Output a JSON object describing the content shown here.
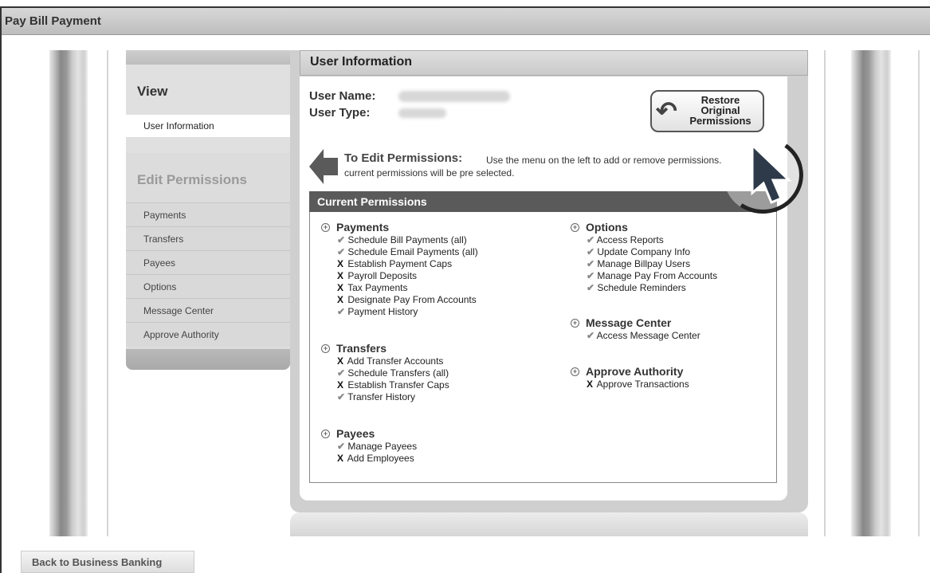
{
  "window": {
    "title": "Pay Bill Payment"
  },
  "sidebar": {
    "view_heading": "View",
    "view_items": [
      {
        "label": "User Information",
        "selected": true
      }
    ],
    "edit_heading": "Edit Permissions",
    "edit_items": [
      {
        "label": "Payments"
      },
      {
        "label": "Transfers"
      },
      {
        "label": "Payees"
      },
      {
        "label": "Options"
      },
      {
        "label": "Message Center"
      },
      {
        "label": "Approve Authority"
      }
    ]
  },
  "main": {
    "header": "User Information",
    "user_name_label": "User Name:",
    "user_type_label": "User Type:",
    "restore_button": "Restore\nOriginal\nPermissions",
    "edit_title": "To Edit Permissions:",
    "edit_desc_line1": "Use the menu on the left to add or remove permissions.",
    "edit_desc_line2": "current permissions will be pre selected.",
    "current_permissions_header": "Current Permissions"
  },
  "permissions": {
    "payments": {
      "title": "Payments",
      "items": [
        {
          "label": "Schedule Bill Payments (all)",
          "granted": true
        },
        {
          "label": "Schedule Email Payments (all)",
          "granted": true
        },
        {
          "label": "Establish Payment Caps",
          "granted": false
        },
        {
          "label": "Payroll Deposits",
          "granted": false
        },
        {
          "label": "Tax Payments",
          "granted": false
        },
        {
          "label": "Designate Pay From Accounts",
          "granted": false
        },
        {
          "label": "Payment History",
          "granted": true
        }
      ]
    },
    "transfers": {
      "title": "Transfers",
      "items": [
        {
          "label": "Add Transfer Accounts",
          "granted": false
        },
        {
          "label": "Schedule Transfers (all)",
          "granted": true
        },
        {
          "label": "Establish Transfer Caps",
          "granted": false
        },
        {
          "label": "Transfer History",
          "granted": true
        }
      ]
    },
    "payees": {
      "title": "Payees",
      "items": [
        {
          "label": "Manage Payees",
          "granted": true
        },
        {
          "label": "Add Employees",
          "granted": false
        }
      ]
    },
    "options": {
      "title": "Options",
      "items": [
        {
          "label": "Access Reports",
          "granted": true
        },
        {
          "label": "Update Company Info",
          "granted": true
        },
        {
          "label": "Manage Billpay Users",
          "granted": true
        },
        {
          "label": "Manage Pay From Accounts",
          "granted": true
        },
        {
          "label": "Schedule Reminders",
          "granted": true
        }
      ]
    },
    "message_center": {
      "title": "Message Center",
      "items": [
        {
          "label": "Access Message Center",
          "granted": true
        }
      ]
    },
    "approve_authority": {
      "title": "Approve Authority",
      "items": [
        {
          "label": "Approve Transactions",
          "granted": false
        }
      ]
    }
  },
  "marks": {
    "granted": "✔",
    "denied": "X"
  },
  "footer": {
    "back_button": "Back to Business Banking"
  }
}
